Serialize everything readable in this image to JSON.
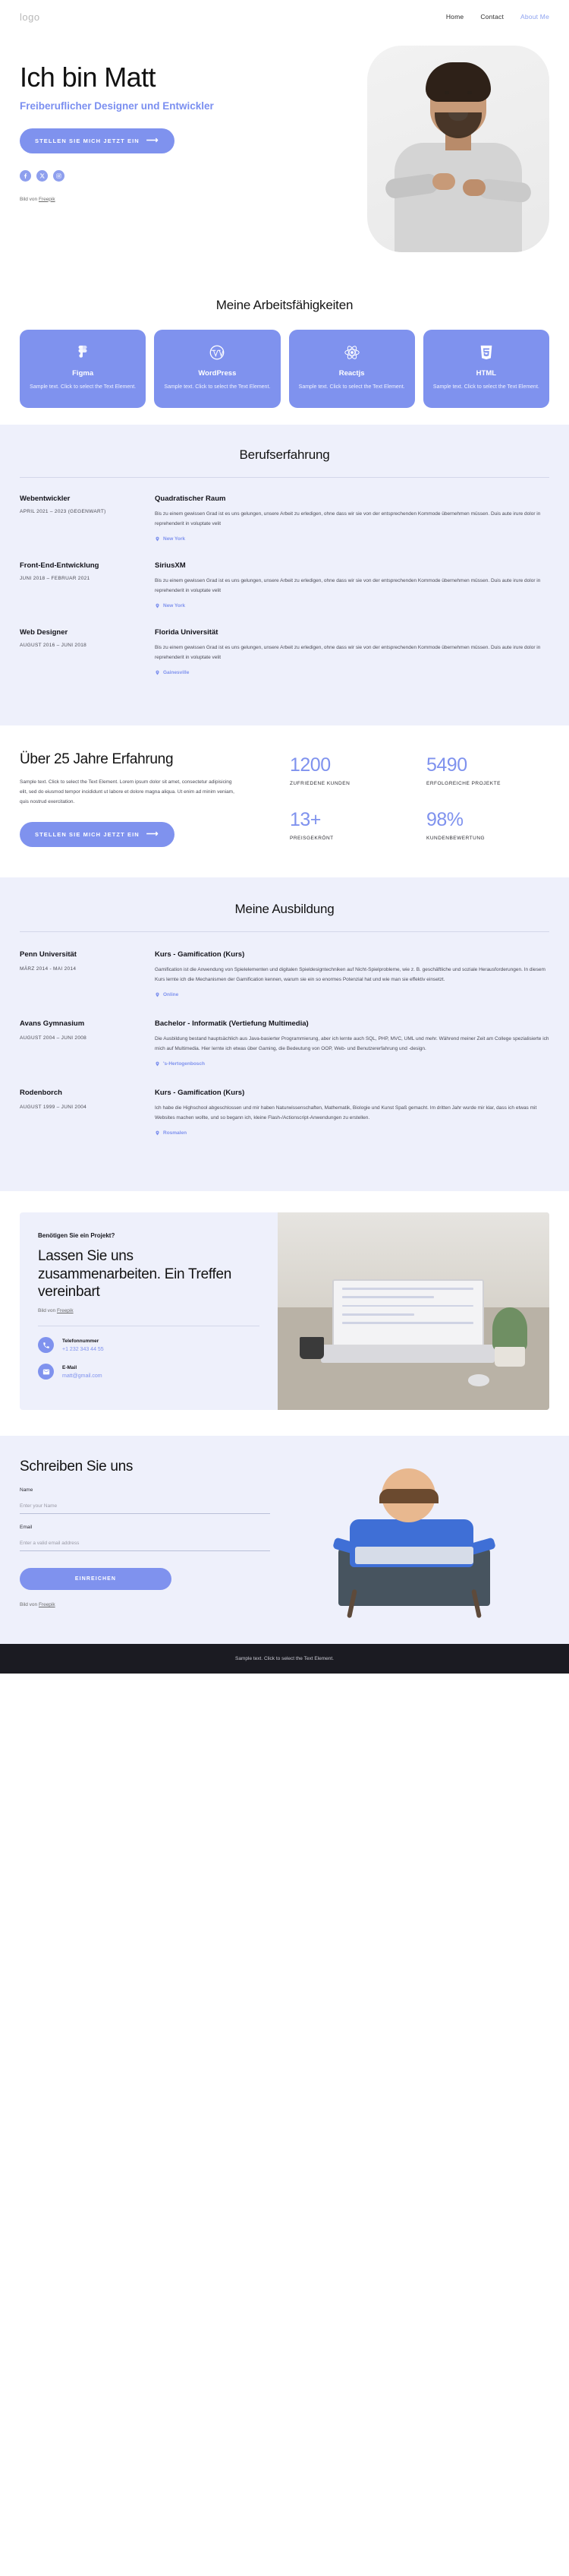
{
  "header": {
    "logo": "logo",
    "nav": [
      {
        "label": "Home",
        "active": false
      },
      {
        "label": "Contact",
        "active": false
      },
      {
        "label": "About Me",
        "active": true
      }
    ]
  },
  "hero": {
    "title": "Ich bin Matt",
    "subtitle": "Freiberuflicher Designer und Entwickler",
    "cta_label": "STELLEN SIE MICH JETZT EIN",
    "cta_arrow": "⟶",
    "socials": [
      {
        "name": "facebook",
        "glyph": "f"
      },
      {
        "name": "x-twitter",
        "glyph": "✕"
      },
      {
        "name": "instagram",
        "glyph": "□"
      }
    ],
    "credit_prefix": "Bild von ",
    "credit_link": "Freepik"
  },
  "skills": {
    "title": "Meine Arbeitsfähigkeiten",
    "cards": [
      {
        "name": "Figma",
        "icon": "figma-icon",
        "desc": "Sample text. Click to select the Text Element."
      },
      {
        "name": "WordPress",
        "icon": "wordpress-icon",
        "desc": "Sample text. Click to select the Text Element."
      },
      {
        "name": "Reactjs",
        "icon": "react-icon",
        "desc": "Sample text. Click to select the Text Element."
      },
      {
        "name": "HTML",
        "icon": "html5-icon",
        "desc": "Sample text. Click to select the Text Element."
      }
    ]
  },
  "experience": {
    "title": "Berufserfahrung",
    "items": [
      {
        "role": "Webentwickler",
        "dates": "APRIL 2021 – 2023 (GEGENWART)",
        "company": "Quadratischer Raum",
        "desc": "Bis zu einem gewissen Grad ist es uns gelungen, unsere Arbeit zu erledigen, ohne dass wir sie von der entsprechenden Kommode übernehmen müssen. Duis aute irure dolor in reprehenderit in voluptate velit",
        "location": "New York"
      },
      {
        "role": "Front-End-Entwicklung",
        "dates": "JUNI 2018 – FEBRUAR 2021",
        "company": "SiriusXM",
        "desc": "Bis zu einem gewissen Grad ist es uns gelungen, unsere Arbeit zu erledigen, ohne dass wir sie von der entsprechenden Kommode übernehmen müssen. Duis aute irure dolor in reprehenderit in voluptate velit",
        "location": "New York"
      },
      {
        "role": "Web Designer",
        "dates": "AUGUST 2016 – JUNI 2018",
        "company": "Florida Universität",
        "desc": "Bis zu einem gewissen Grad ist es uns gelungen, unsere Arbeit zu erledigen, ohne dass wir sie von der entsprechenden Kommode übernehmen müssen. Duis aute irure dolor in reprehenderit in voluptate velit",
        "location": "Gainesville"
      }
    ]
  },
  "stats": {
    "heading": "Über 25 Jahre Erfahrung",
    "text": "Sample text. Click to select the Text Element. Lorem ipsum dolor sit amet, consectetur adipisicing elit, sed do eiusmod tempor incididunt ut labore et dolore magna aliqua. Ut enim ad minim veniam, quis nostrud exercitation.",
    "cta_label": "STELLEN SIE MICH JETZT EIN",
    "cta_arrow": "⟶",
    "items": [
      {
        "value": "1200",
        "label": "ZUFRIEDENE KUNDEN"
      },
      {
        "value": "5490",
        "label": "ERFOLGREICHE PROJEKTE"
      },
      {
        "value": "13+",
        "label": "PREISGEKRÖNT"
      },
      {
        "value": "98%",
        "label": "KUNDENBEWERTUNG"
      }
    ]
  },
  "education": {
    "title": "Meine Ausbildung",
    "items": [
      {
        "school": "Penn Universität",
        "dates": "MÄRZ 2014 - MAI 2014",
        "course": "Kurs - Gamification (Kurs)",
        "desc": "Gamification ist die Anwendung von Spielelementen und digitalen Spieldesigntechniken auf Nicht-Spielprobleme, wie z. B. geschäftliche und soziale Herausforderungen. In diesem Kurs lernte ich die Mechanismen der Gamification kennen, warum sie ein so enormes Potenzial hat und wie man sie effektiv einsetzt.",
        "location": "Online"
      },
      {
        "school": "Avans Gymnasium",
        "dates": "AUGUST 2004 – JUNI 2008",
        "course": "Bachelor - Informatik (Vertiefung Multimedia)",
        "desc": "Die Ausbildung bestand hauptsächlich aus Java-basierter Programmierung, aber ich lernte auch SQL, PHP, MVC, UML und mehr. Während meiner Zeit am College spezialisierte ich mich auf Multimedia. Hier lernte ich etwas über Gaming, die Bedeutung von OOP, Web- und Benutzererfahrung und -design.",
        "location": "'s-Hertogenbosch"
      },
      {
        "school": "Rodenborch",
        "dates": "AUGUST 1999 – JUNI 2004",
        "course": "Kurs - Gamification (Kurs)",
        "desc": "Ich habe die Highschool abgeschlossen und mir haben Naturwissenschaften, Mathematik, Biologie und Kunst Spaß gemacht. Im dritten Jahr wurde mir klar, dass ich etwas mit Websites machen wollte, und so begann ich, kleine Flash-/Actionscript-Anwendungen zu erstellen.",
        "location": "Rosmalen"
      }
    ]
  },
  "cta": {
    "kicker": "Benötigen Sie ein Projekt?",
    "title": "Lassen Sie uns zusammenarbeiten. Ein Treffen vereinbart",
    "credit_prefix": "Bild von ",
    "credit_link": "Freepik",
    "contacts": [
      {
        "icon": "phone-icon",
        "label": "Telefonnummer",
        "value": "+1 232 343 44 55"
      },
      {
        "icon": "mail-icon",
        "label": "E-Mail",
        "value": "matt@gmail.com"
      }
    ]
  },
  "contact_form": {
    "title": "Schreiben Sie uns",
    "fields": [
      {
        "label": "Name",
        "placeholder": "Enter your Name",
        "value": ""
      },
      {
        "label": "Email",
        "placeholder": "Enter a valid email address",
        "value": ""
      }
    ],
    "submit_label": "EINREICHEN",
    "credit_prefix": "Bild von ",
    "credit_link": "Freepik"
  },
  "footer": {
    "text": "Sample text. Click to select the Text Element."
  }
}
